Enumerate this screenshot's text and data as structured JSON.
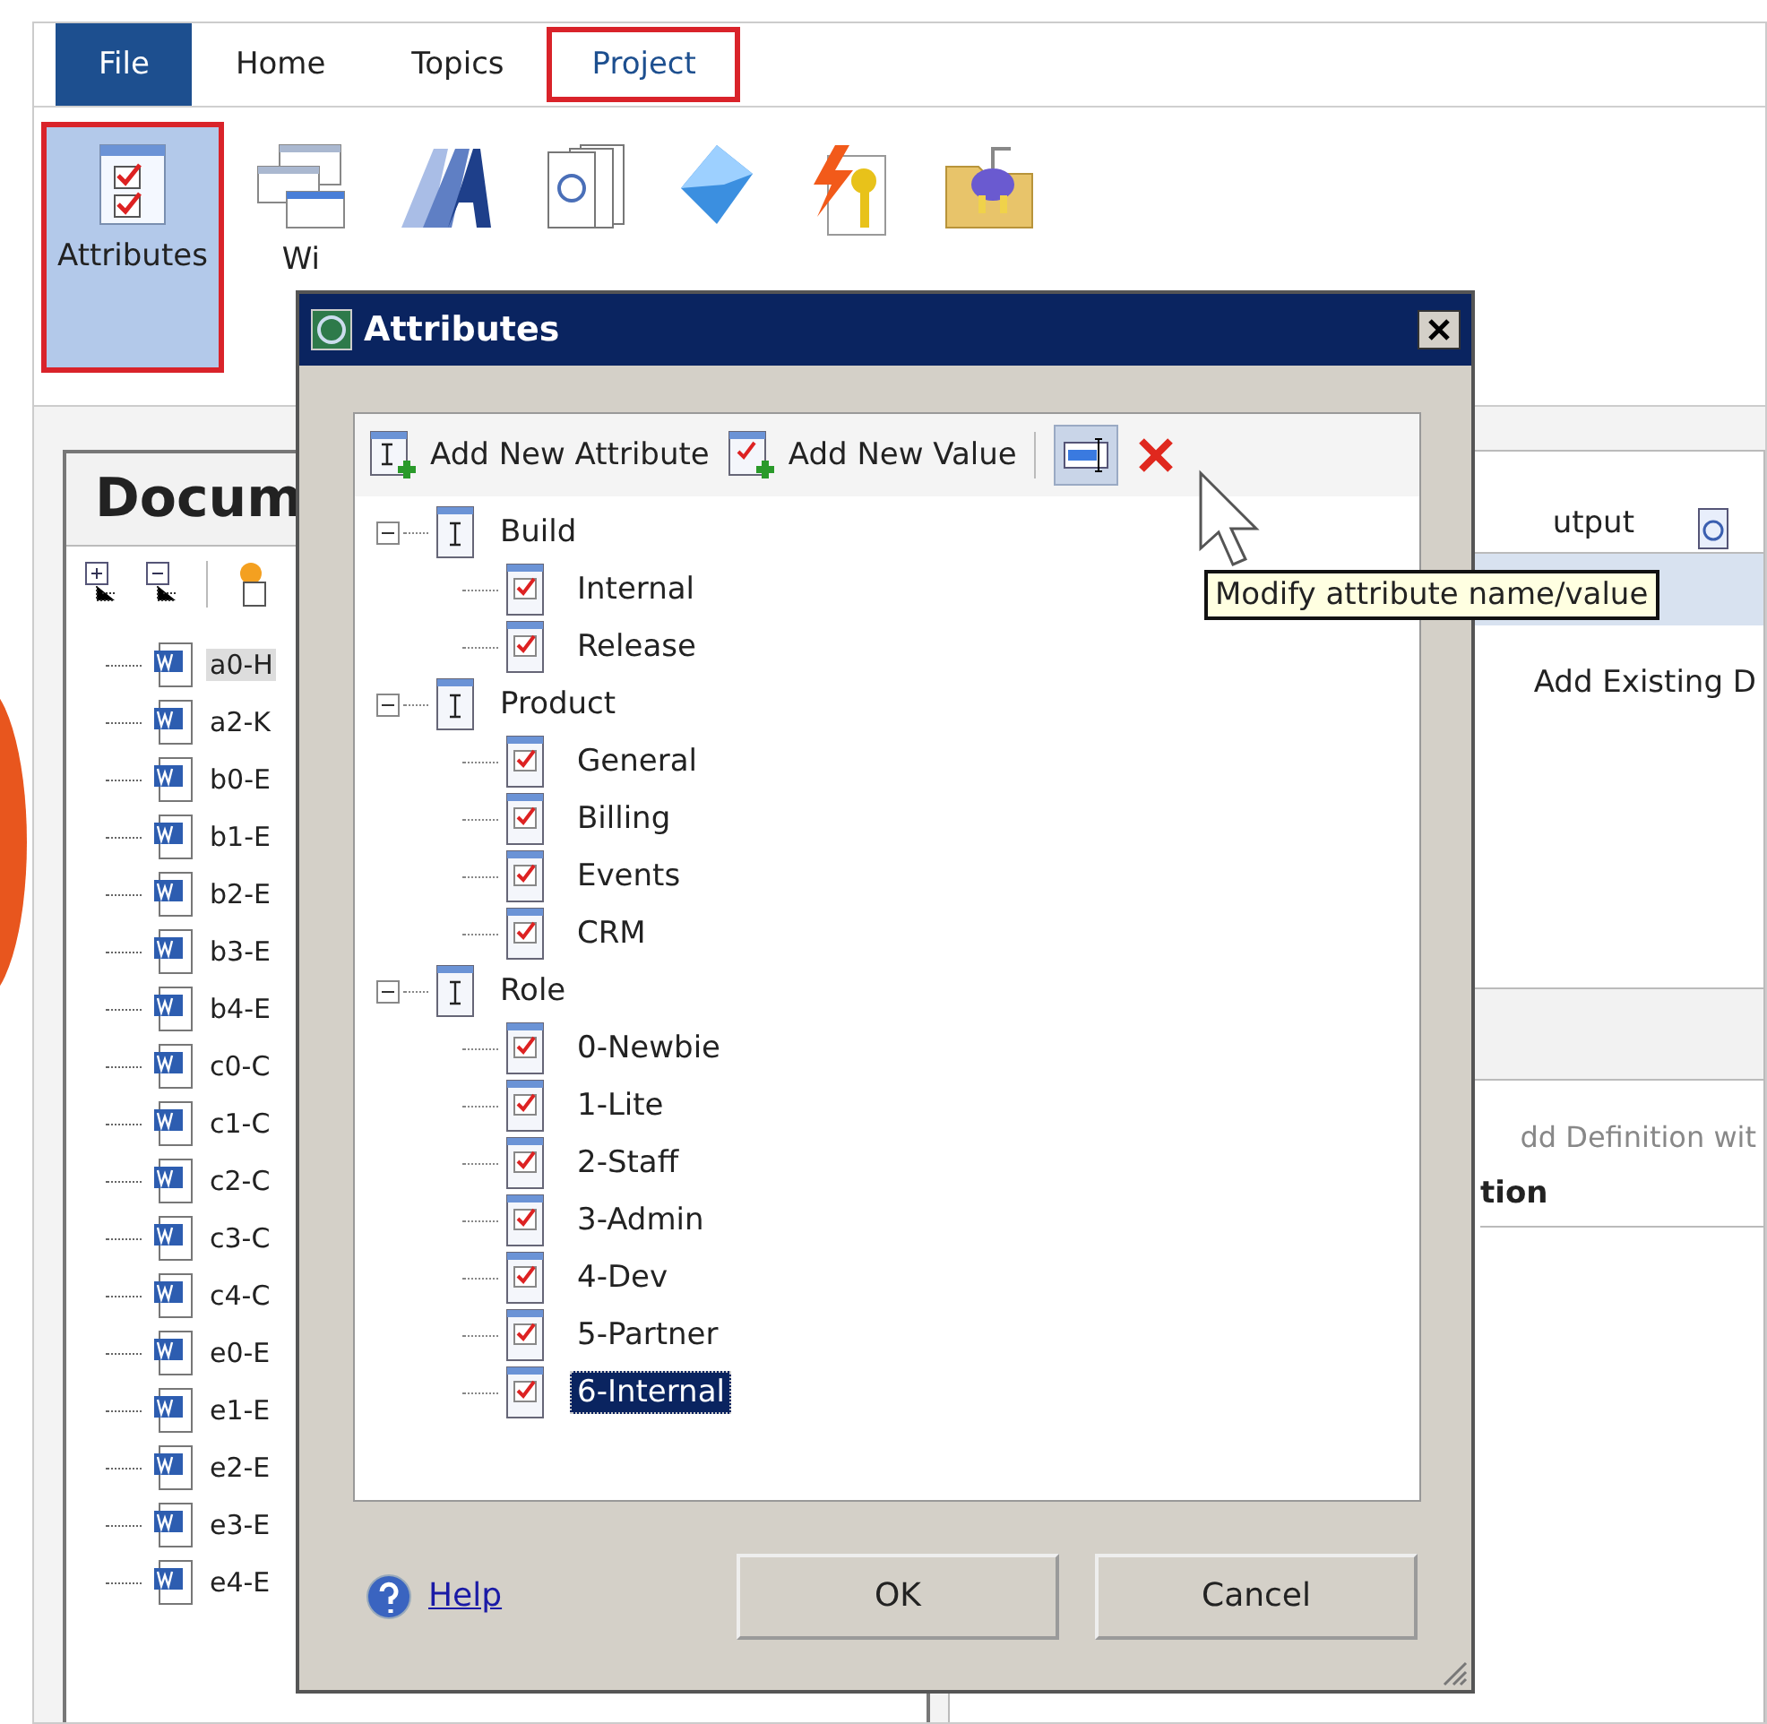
{
  "ribbon_tabs": [
    {
      "label": "File",
      "kind": "file",
      "highlighted": false
    },
    {
      "label": "Home",
      "kind": "tab",
      "highlighted": false
    },
    {
      "label": "Topics",
      "kind": "tab",
      "highlighted": false
    },
    {
      "label": "Project",
      "kind": "tab",
      "highlighted": true
    }
  ],
  "ribbon_buttons": [
    {
      "label": "Attributes",
      "highlighted": true
    },
    {
      "label": "Wi",
      "highlighted": false
    },
    {
      "highlighted": false
    },
    {
      "highlighted": false
    },
    {
      "highlighted": false
    },
    {
      "highlighted": false
    },
    {
      "highlighted": false
    }
  ],
  "documents_panel": {
    "title": "Docum",
    "files": [
      "a0-H",
      "a2-K",
      "b0-E",
      "b1-E",
      "b2-E",
      "b3-E",
      "b4-E",
      "c0-C",
      "c1-C",
      "c2-C",
      "c3-C",
      "c4-C",
      "e0-E",
      "e1-E",
      "e2-E",
      "e3-E",
      "e4-E"
    ]
  },
  "right_panel": {
    "tab": "utput",
    "action": "Add Existing D",
    "hint": "dd Definition wit",
    "column": "tion"
  },
  "dialog": {
    "title": "Attributes",
    "toolbar": [
      "Add New Attribute",
      "Add New Value"
    ],
    "tooltip": "Modify attribute name/value",
    "attributes": [
      {
        "name": "Build",
        "expanded": true,
        "children": [
          {
            "name": "Internal",
            "selected": false
          },
          {
            "name": "Release",
            "selected": false
          }
        ]
      },
      {
        "name": "Product",
        "expanded": true,
        "children": [
          {
            "name": "General",
            "selected": false
          },
          {
            "name": "Billing",
            "selected": false
          },
          {
            "name": "Events",
            "selected": false
          },
          {
            "name": "CRM",
            "selected": false
          }
        ]
      },
      {
        "name": "Role",
        "expanded": true,
        "children": [
          {
            "name": "0-Newbie",
            "selected": false
          },
          {
            "name": "1-Lite",
            "selected": false
          },
          {
            "name": "2-Staff",
            "selected": false
          },
          {
            "name": "3-Admin",
            "selected": false
          },
          {
            "name": "4-Dev",
            "selected": false
          },
          {
            "name": "5-Partner",
            "selected": false
          },
          {
            "name": "6-Internal",
            "selected": true
          }
        ]
      }
    ],
    "help_link": "Help",
    "buttons": [
      "OK",
      "Cancel"
    ]
  }
}
